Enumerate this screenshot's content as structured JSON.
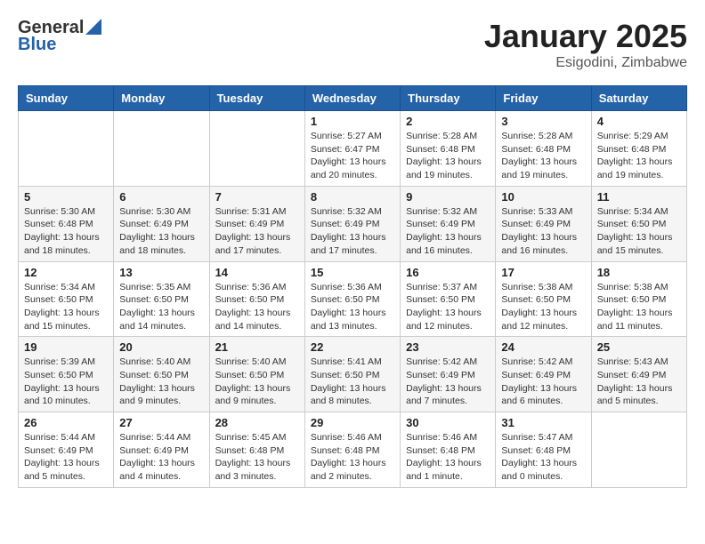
{
  "header": {
    "logo_general": "General",
    "logo_blue": "Blue",
    "month": "January 2025",
    "location": "Esigodini, Zimbabwe"
  },
  "days_of_week": [
    "Sunday",
    "Monday",
    "Tuesday",
    "Wednesday",
    "Thursday",
    "Friday",
    "Saturday"
  ],
  "weeks": [
    [
      {
        "day": "",
        "info": ""
      },
      {
        "day": "",
        "info": ""
      },
      {
        "day": "",
        "info": ""
      },
      {
        "day": "1",
        "info": "Sunrise: 5:27 AM\nSunset: 6:47 PM\nDaylight: 13 hours\nand 20 minutes."
      },
      {
        "day": "2",
        "info": "Sunrise: 5:28 AM\nSunset: 6:48 PM\nDaylight: 13 hours\nand 19 minutes."
      },
      {
        "day": "3",
        "info": "Sunrise: 5:28 AM\nSunset: 6:48 PM\nDaylight: 13 hours\nand 19 minutes."
      },
      {
        "day": "4",
        "info": "Sunrise: 5:29 AM\nSunset: 6:48 PM\nDaylight: 13 hours\nand 19 minutes."
      }
    ],
    [
      {
        "day": "5",
        "info": "Sunrise: 5:30 AM\nSunset: 6:48 PM\nDaylight: 13 hours\nand 18 minutes."
      },
      {
        "day": "6",
        "info": "Sunrise: 5:30 AM\nSunset: 6:49 PM\nDaylight: 13 hours\nand 18 minutes."
      },
      {
        "day": "7",
        "info": "Sunrise: 5:31 AM\nSunset: 6:49 PM\nDaylight: 13 hours\nand 17 minutes."
      },
      {
        "day": "8",
        "info": "Sunrise: 5:32 AM\nSunset: 6:49 PM\nDaylight: 13 hours\nand 17 minutes."
      },
      {
        "day": "9",
        "info": "Sunrise: 5:32 AM\nSunset: 6:49 PM\nDaylight: 13 hours\nand 16 minutes."
      },
      {
        "day": "10",
        "info": "Sunrise: 5:33 AM\nSunset: 6:49 PM\nDaylight: 13 hours\nand 16 minutes."
      },
      {
        "day": "11",
        "info": "Sunrise: 5:34 AM\nSunset: 6:50 PM\nDaylight: 13 hours\nand 15 minutes."
      }
    ],
    [
      {
        "day": "12",
        "info": "Sunrise: 5:34 AM\nSunset: 6:50 PM\nDaylight: 13 hours\nand 15 minutes."
      },
      {
        "day": "13",
        "info": "Sunrise: 5:35 AM\nSunset: 6:50 PM\nDaylight: 13 hours\nand 14 minutes."
      },
      {
        "day": "14",
        "info": "Sunrise: 5:36 AM\nSunset: 6:50 PM\nDaylight: 13 hours\nand 14 minutes."
      },
      {
        "day": "15",
        "info": "Sunrise: 5:36 AM\nSunset: 6:50 PM\nDaylight: 13 hours\nand 13 minutes."
      },
      {
        "day": "16",
        "info": "Sunrise: 5:37 AM\nSunset: 6:50 PM\nDaylight: 13 hours\nand 12 minutes."
      },
      {
        "day": "17",
        "info": "Sunrise: 5:38 AM\nSunset: 6:50 PM\nDaylight: 13 hours\nand 12 minutes."
      },
      {
        "day": "18",
        "info": "Sunrise: 5:38 AM\nSunset: 6:50 PM\nDaylight: 13 hours\nand 11 minutes."
      }
    ],
    [
      {
        "day": "19",
        "info": "Sunrise: 5:39 AM\nSunset: 6:50 PM\nDaylight: 13 hours\nand 10 minutes."
      },
      {
        "day": "20",
        "info": "Sunrise: 5:40 AM\nSunset: 6:50 PM\nDaylight: 13 hours\nand 9 minutes."
      },
      {
        "day": "21",
        "info": "Sunrise: 5:40 AM\nSunset: 6:50 PM\nDaylight: 13 hours\nand 9 minutes."
      },
      {
        "day": "22",
        "info": "Sunrise: 5:41 AM\nSunset: 6:50 PM\nDaylight: 13 hours\nand 8 minutes."
      },
      {
        "day": "23",
        "info": "Sunrise: 5:42 AM\nSunset: 6:49 PM\nDaylight: 13 hours\nand 7 minutes."
      },
      {
        "day": "24",
        "info": "Sunrise: 5:42 AM\nSunset: 6:49 PM\nDaylight: 13 hours\nand 6 minutes."
      },
      {
        "day": "25",
        "info": "Sunrise: 5:43 AM\nSunset: 6:49 PM\nDaylight: 13 hours\nand 5 minutes."
      }
    ],
    [
      {
        "day": "26",
        "info": "Sunrise: 5:44 AM\nSunset: 6:49 PM\nDaylight: 13 hours\nand 5 minutes."
      },
      {
        "day": "27",
        "info": "Sunrise: 5:44 AM\nSunset: 6:49 PM\nDaylight: 13 hours\nand 4 minutes."
      },
      {
        "day": "28",
        "info": "Sunrise: 5:45 AM\nSunset: 6:48 PM\nDaylight: 13 hours\nand 3 minutes."
      },
      {
        "day": "29",
        "info": "Sunrise: 5:46 AM\nSunset: 6:48 PM\nDaylight: 13 hours\nand 2 minutes."
      },
      {
        "day": "30",
        "info": "Sunrise: 5:46 AM\nSunset: 6:48 PM\nDaylight: 13 hours\nand 1 minute."
      },
      {
        "day": "31",
        "info": "Sunrise: 5:47 AM\nSunset: 6:48 PM\nDaylight: 13 hours\nand 0 minutes."
      },
      {
        "day": "",
        "info": ""
      }
    ]
  ]
}
